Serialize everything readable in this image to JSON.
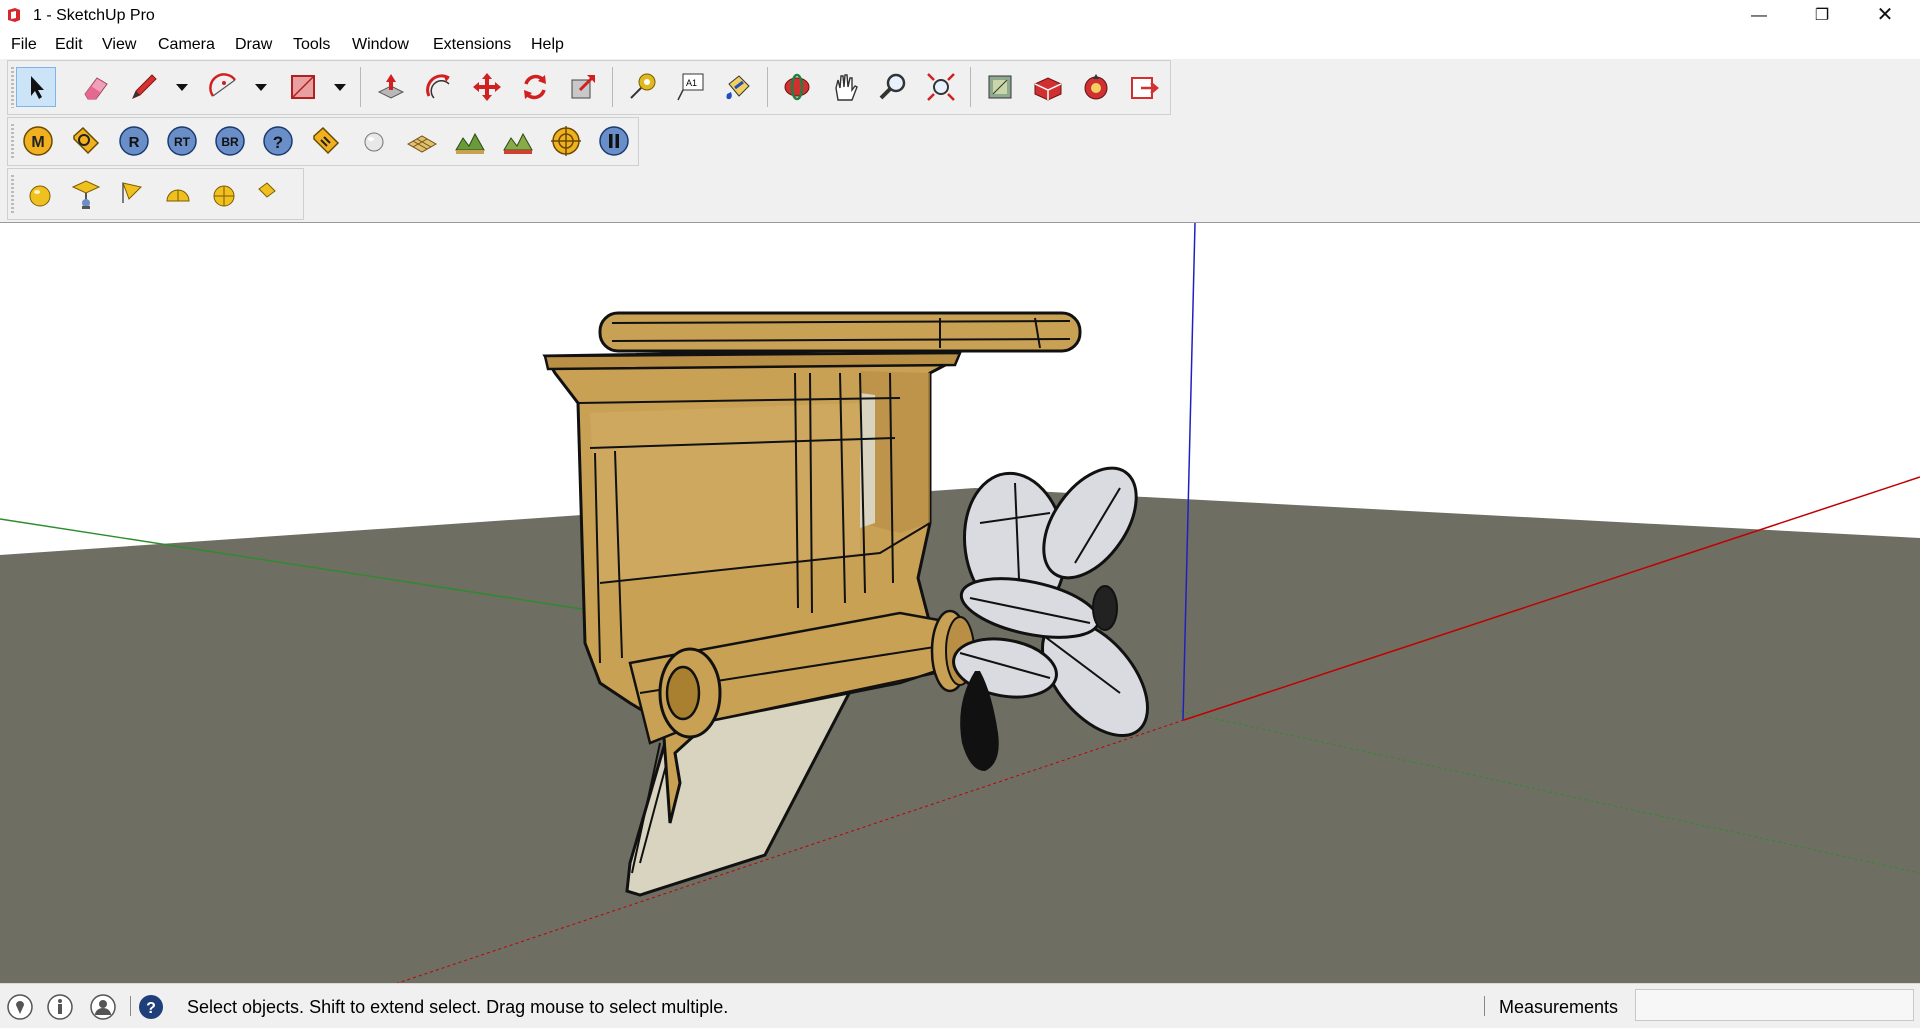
{
  "window": {
    "title": "1 - SketchUp Pro",
    "minimize_glyph": "—",
    "maximize_glyph": "❐",
    "close_glyph": "✕"
  },
  "menu": [
    "File",
    "Edit",
    "View",
    "Camera",
    "Draw",
    "Tools",
    "Window",
    "Extensions",
    "Help"
  ],
  "toolbar_main": {
    "tools": [
      "select-icon",
      "eraser-icon",
      "pencil-icon",
      "arc-icon",
      "rectangle-icon",
      "push-pull-icon",
      "offset-icon",
      "move-icon",
      "rotate-icon",
      "scale-icon",
      "tape-measure-icon",
      "text-label-icon",
      "paint-bucket-icon",
      "orbit-icon",
      "pan-icon",
      "zoom-icon",
      "zoom-extents-icon",
      "3d-warehouse-icon",
      "extension-warehouse-icon",
      "layout-icon",
      "send-to-layout-icon"
    ],
    "selected": "select-icon"
  },
  "toolbar_render": {
    "labels": [
      "M",
      "",
      "R",
      "RT",
      "BR",
      "?",
      "",
      "",
      "",
      "",
      "",
      "",
      ""
    ],
    "tools": [
      "material-editor-icon",
      "tag-editor-icon",
      "render-icon",
      "render-tile-icon",
      "batch-render-icon",
      "help-icon",
      "tag-icon",
      "sphere-icon",
      "ground-plane-icon",
      "landscape-icon",
      "landscape-edit-icon",
      "target-icon",
      "pause-icon"
    ]
  },
  "toolbar_lights": {
    "tools": [
      "omni-light-icon",
      "spot-light-icon",
      "flag-light-icon",
      "dome-light-icon",
      "sphere-light-icon",
      "light-edit-icon"
    ]
  },
  "colors": {
    "ground": "#6f6e62",
    "sky": "#ffffff",
    "model_wood": "#c9a154",
    "rudder": "#d8d4c0",
    "propeller": "#d9dbe0",
    "axis_red": "#c00000",
    "axis_green": "#2c8c2c",
    "axis_blue": "#2020c0"
  },
  "status": {
    "text": "Select objects. Shift to extend select. Drag mouse to select multiple.",
    "measurements_label": "Measurements",
    "measurements_value": "",
    "icons": [
      "geo-location-icon",
      "credits-icon",
      "user-account-icon",
      "instructor-help-icon"
    ]
  }
}
